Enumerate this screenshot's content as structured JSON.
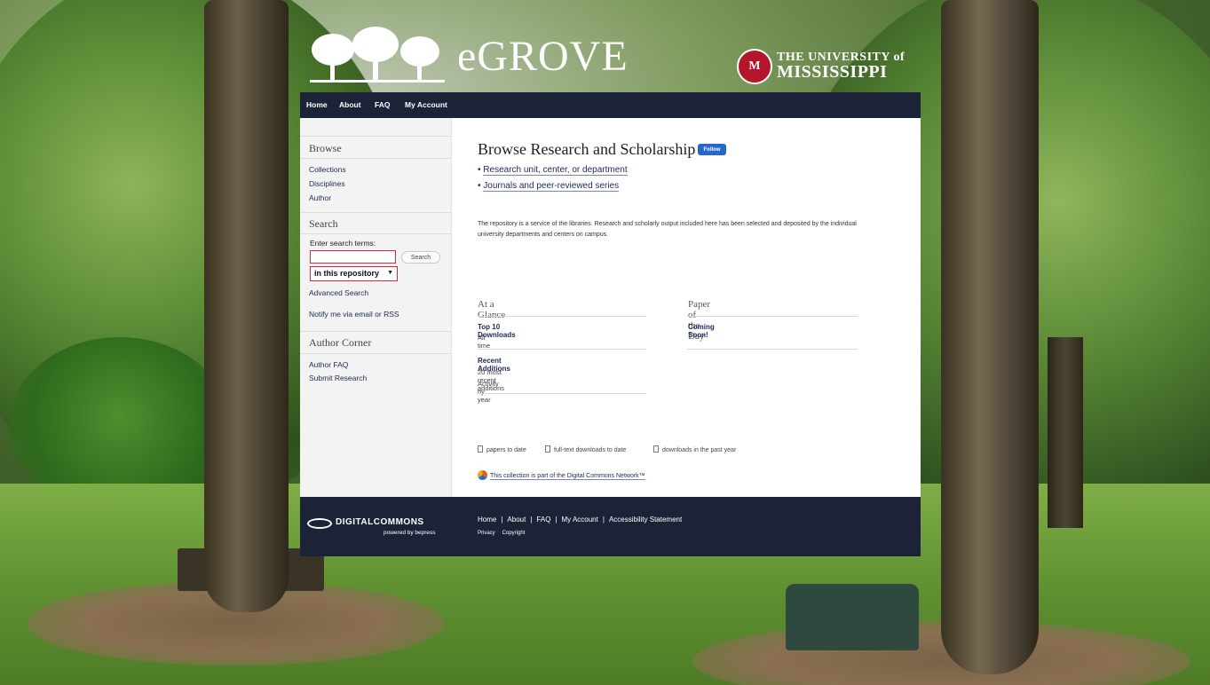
{
  "header": {
    "site_title": "eGROVE",
    "university_line1": "THE UNIVERSITY of",
    "university_line2": "MISSISSIPPI",
    "seal_text": "M"
  },
  "nav": {
    "items": [
      {
        "label": "Home"
      },
      {
        "label": "About"
      },
      {
        "label": "FAQ"
      },
      {
        "label": "My Account"
      }
    ]
  },
  "sidebar": {
    "browse_heading": "Browse",
    "browse_items": [
      {
        "label": "Collections"
      },
      {
        "label": "Disciplines"
      },
      {
        "label": "Author"
      }
    ],
    "search_heading": "Search",
    "search_label": "Enter search terms:",
    "search_value": "",
    "search_button": "Search",
    "scope_selected": "in this repository",
    "advanced_search": "Advanced Search",
    "notify": "Notify me via email or RSS",
    "author_heading": "Author Corner",
    "author_items": [
      {
        "label": "Author FAQ"
      },
      {
        "label": "Submit Research"
      }
    ]
  },
  "main": {
    "title": "Browse Research and Scholarship",
    "follow_label": "Follow",
    "links": [
      {
        "label": "Research unit, center, or department"
      },
      {
        "label": "Journals and peer-reviewed series"
      }
    ],
    "intro": "The repository is a service of the libraries. Research and scholarly output included here has been selected and deposited by the individual university departments and centers on campus.",
    "glance": {
      "heading": "At a Glance",
      "top10_label": "Top 10 Downloads",
      "top10_sub": "All time",
      "recent_label": "Recent Additions",
      "recent_sub1": "20 most recent additions",
      "recent_sub2": "Activity by year"
    },
    "paper_of_day": {
      "heading": "Paper of the Day",
      "coming": "Coming Soon!"
    },
    "stats": [
      {
        "label": "papers to date"
      },
      {
        "label": "full-text downloads to date"
      },
      {
        "label": "downloads in the past year"
      }
    ],
    "network_text": "This collection is part of the Digital Commons Network™"
  },
  "footer": {
    "brand": "DIGITALCOMMONS",
    "brand_sub": "powered by bepress",
    "links": [
      {
        "label": "Home"
      },
      {
        "label": "About"
      },
      {
        "label": "FAQ"
      },
      {
        "label": "My Account"
      },
      {
        "label": "Accessibility Statement"
      }
    ],
    "small_links": [
      {
        "label": "Privacy"
      },
      {
        "label": "Copyright"
      }
    ]
  },
  "colors": {
    "nav_bg": "#1c2237",
    "link": "#1c2a55",
    "follow": "#2466c9",
    "search_border": "#d4283f",
    "seal": "#b3162b"
  }
}
